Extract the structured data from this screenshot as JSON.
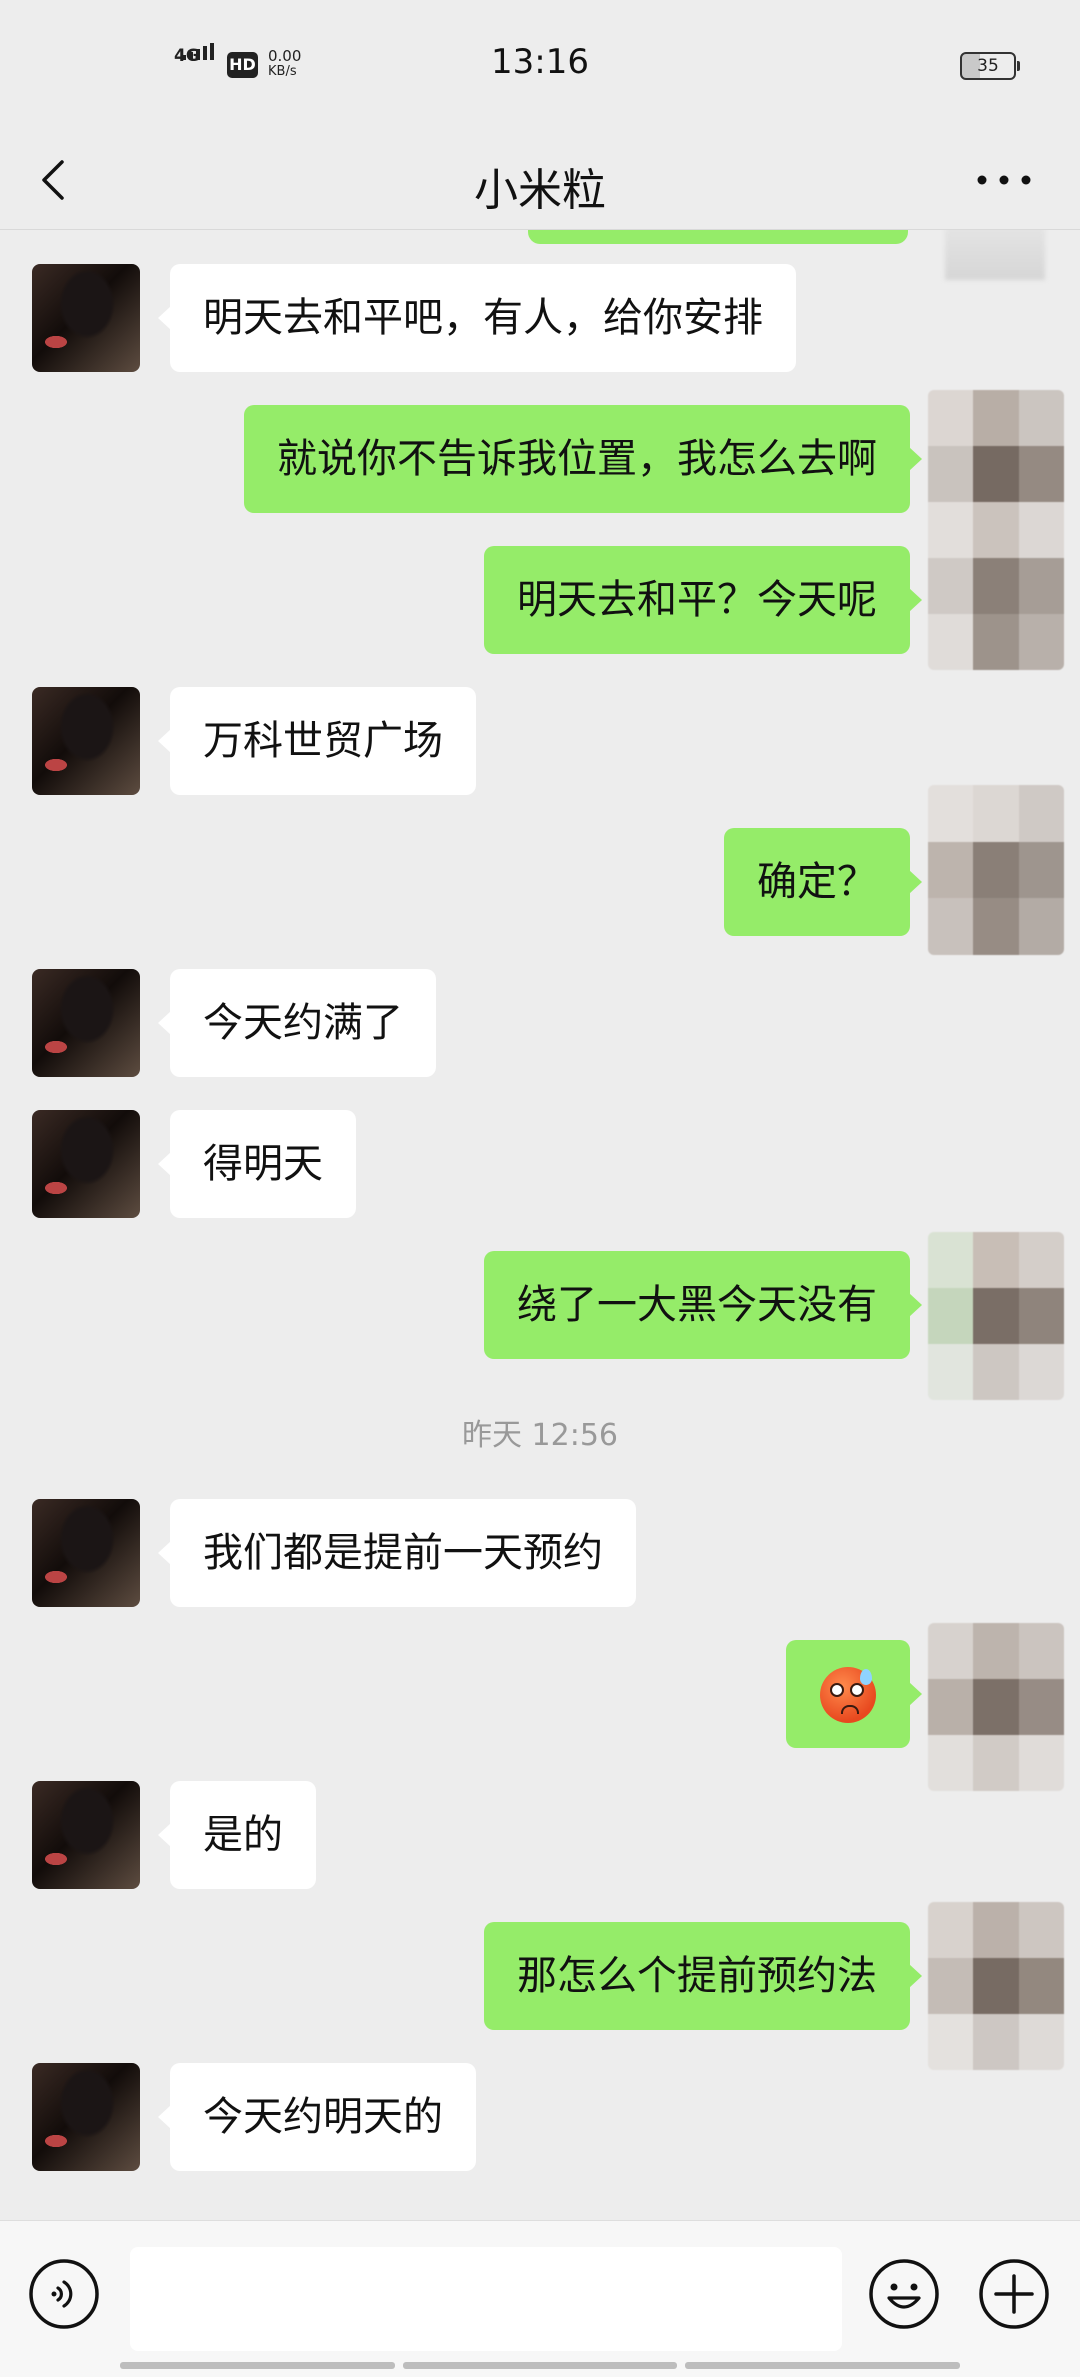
{
  "status_bar": {
    "network": "4G",
    "hd": "HD",
    "speed_value": "0.00",
    "speed_unit": "KB/s",
    "time": "13:16",
    "battery": "35"
  },
  "header": {
    "title": "小米粒"
  },
  "messages": [
    {
      "side": "in",
      "text": "明天去和平吧，有人，给你安排"
    },
    {
      "side": "out",
      "text": "就说你不告诉我位置，我怎么去啊"
    },
    {
      "side": "out",
      "text": "明天去和平？今天呢"
    },
    {
      "side": "in",
      "text": "万科世贸广场"
    },
    {
      "side": "out",
      "text": "确定？"
    },
    {
      "side": "in",
      "text": "今天约满了"
    },
    {
      "side": "in",
      "text": "得明天"
    },
    {
      "side": "out",
      "text": "绕了一大黑今天没有"
    },
    {
      "side": "time",
      "text": "昨天 12:56"
    },
    {
      "side": "in",
      "text": "我们都是提前一天预约"
    },
    {
      "side": "out",
      "type": "emoji",
      "emoji": "anxious-sweat-face-icon"
    },
    {
      "side": "in",
      "text": "是的"
    },
    {
      "side": "out",
      "text": "那怎么个提前预约法"
    },
    {
      "side": "in",
      "text": "今天约明天的"
    }
  ],
  "input_bar": {
    "message_value": "",
    "icons": [
      "voice-icon",
      "emoji-icon",
      "plus-icon"
    ]
  },
  "colors": {
    "background": "#ededed",
    "bubble_out": "#95ec69",
    "bubble_in": "#ffffff",
    "timestamp": "#999999"
  }
}
